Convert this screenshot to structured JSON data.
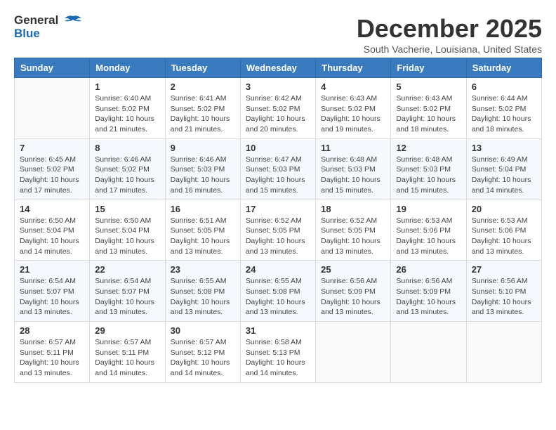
{
  "logo": {
    "line1": "General",
    "line2": "Blue"
  },
  "title": "December 2025",
  "subtitle": "South Vacherie, Louisiana, United States",
  "headers": [
    "Sunday",
    "Monday",
    "Tuesday",
    "Wednesday",
    "Thursday",
    "Friday",
    "Saturday"
  ],
  "weeks": [
    [
      {
        "day": "",
        "info": ""
      },
      {
        "day": "1",
        "info": "Sunrise: 6:40 AM\nSunset: 5:02 PM\nDaylight: 10 hours\nand 21 minutes."
      },
      {
        "day": "2",
        "info": "Sunrise: 6:41 AM\nSunset: 5:02 PM\nDaylight: 10 hours\nand 21 minutes."
      },
      {
        "day": "3",
        "info": "Sunrise: 6:42 AM\nSunset: 5:02 PM\nDaylight: 10 hours\nand 20 minutes."
      },
      {
        "day": "4",
        "info": "Sunrise: 6:43 AM\nSunset: 5:02 PM\nDaylight: 10 hours\nand 19 minutes."
      },
      {
        "day": "5",
        "info": "Sunrise: 6:43 AM\nSunset: 5:02 PM\nDaylight: 10 hours\nand 18 minutes."
      },
      {
        "day": "6",
        "info": "Sunrise: 6:44 AM\nSunset: 5:02 PM\nDaylight: 10 hours\nand 18 minutes."
      }
    ],
    [
      {
        "day": "7",
        "info": "Sunrise: 6:45 AM\nSunset: 5:02 PM\nDaylight: 10 hours\nand 17 minutes."
      },
      {
        "day": "8",
        "info": "Sunrise: 6:46 AM\nSunset: 5:02 PM\nDaylight: 10 hours\nand 17 minutes."
      },
      {
        "day": "9",
        "info": "Sunrise: 6:46 AM\nSunset: 5:03 PM\nDaylight: 10 hours\nand 16 minutes."
      },
      {
        "day": "10",
        "info": "Sunrise: 6:47 AM\nSunset: 5:03 PM\nDaylight: 10 hours\nand 15 minutes."
      },
      {
        "day": "11",
        "info": "Sunrise: 6:48 AM\nSunset: 5:03 PM\nDaylight: 10 hours\nand 15 minutes."
      },
      {
        "day": "12",
        "info": "Sunrise: 6:48 AM\nSunset: 5:03 PM\nDaylight: 10 hours\nand 15 minutes."
      },
      {
        "day": "13",
        "info": "Sunrise: 6:49 AM\nSunset: 5:04 PM\nDaylight: 10 hours\nand 14 minutes."
      }
    ],
    [
      {
        "day": "14",
        "info": "Sunrise: 6:50 AM\nSunset: 5:04 PM\nDaylight: 10 hours\nand 14 minutes."
      },
      {
        "day": "15",
        "info": "Sunrise: 6:50 AM\nSunset: 5:04 PM\nDaylight: 10 hours\nand 13 minutes."
      },
      {
        "day": "16",
        "info": "Sunrise: 6:51 AM\nSunset: 5:05 PM\nDaylight: 10 hours\nand 13 minutes."
      },
      {
        "day": "17",
        "info": "Sunrise: 6:52 AM\nSunset: 5:05 PM\nDaylight: 10 hours\nand 13 minutes."
      },
      {
        "day": "18",
        "info": "Sunrise: 6:52 AM\nSunset: 5:05 PM\nDaylight: 10 hours\nand 13 minutes."
      },
      {
        "day": "19",
        "info": "Sunrise: 6:53 AM\nSunset: 5:06 PM\nDaylight: 10 hours\nand 13 minutes."
      },
      {
        "day": "20",
        "info": "Sunrise: 6:53 AM\nSunset: 5:06 PM\nDaylight: 10 hours\nand 13 minutes."
      }
    ],
    [
      {
        "day": "21",
        "info": "Sunrise: 6:54 AM\nSunset: 5:07 PM\nDaylight: 10 hours\nand 13 minutes."
      },
      {
        "day": "22",
        "info": "Sunrise: 6:54 AM\nSunset: 5:07 PM\nDaylight: 10 hours\nand 13 minutes."
      },
      {
        "day": "23",
        "info": "Sunrise: 6:55 AM\nSunset: 5:08 PM\nDaylight: 10 hours\nand 13 minutes."
      },
      {
        "day": "24",
        "info": "Sunrise: 6:55 AM\nSunset: 5:08 PM\nDaylight: 10 hours\nand 13 minutes."
      },
      {
        "day": "25",
        "info": "Sunrise: 6:56 AM\nSunset: 5:09 PM\nDaylight: 10 hours\nand 13 minutes."
      },
      {
        "day": "26",
        "info": "Sunrise: 6:56 AM\nSunset: 5:09 PM\nDaylight: 10 hours\nand 13 minutes."
      },
      {
        "day": "27",
        "info": "Sunrise: 6:56 AM\nSunset: 5:10 PM\nDaylight: 10 hours\nand 13 minutes."
      }
    ],
    [
      {
        "day": "28",
        "info": "Sunrise: 6:57 AM\nSunset: 5:11 PM\nDaylight: 10 hours\nand 13 minutes."
      },
      {
        "day": "29",
        "info": "Sunrise: 6:57 AM\nSunset: 5:11 PM\nDaylight: 10 hours\nand 14 minutes."
      },
      {
        "day": "30",
        "info": "Sunrise: 6:57 AM\nSunset: 5:12 PM\nDaylight: 10 hours\nand 14 minutes."
      },
      {
        "day": "31",
        "info": "Sunrise: 6:58 AM\nSunset: 5:13 PM\nDaylight: 10 hours\nand 14 minutes."
      },
      {
        "day": "",
        "info": ""
      },
      {
        "day": "",
        "info": ""
      },
      {
        "day": "",
        "info": ""
      }
    ]
  ]
}
